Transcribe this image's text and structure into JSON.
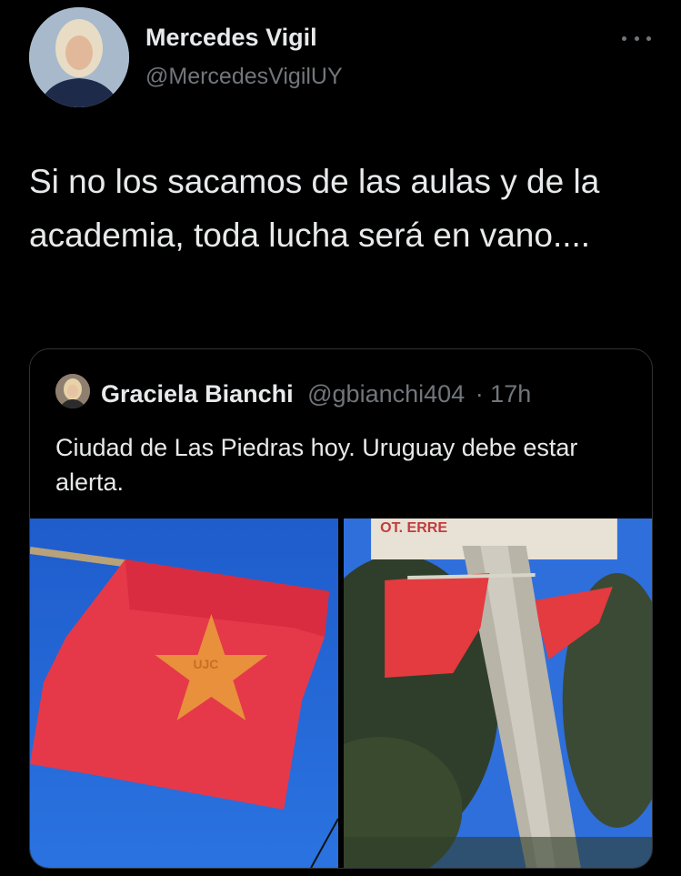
{
  "tweet": {
    "author": {
      "name": "Mercedes Vigil",
      "handle": "@MercedesVigilUY"
    },
    "more_icon": "more-icon",
    "text": "Si no los sacamos de las aulas y de la academia, toda lucha será en vano...."
  },
  "quoted_tweet": {
    "author": {
      "name": "Graciela Bianchi",
      "handle": "@gbianchi404",
      "time": "· 17h"
    },
    "text": "Ciudad de Las Piedras hoy. Uruguay debe estar alerta.",
    "media": [
      {
        "description_icon": "photo",
        "flag_text": "UJC"
      },
      {
        "description_icon": "photo",
        "sign_text": "OT. ERRE"
      }
    ]
  },
  "colors": {
    "background": "#000000",
    "text_primary": "#e7e9ea",
    "text_secondary": "#71767b",
    "border": "#2f3336",
    "flag_red": "#e5394a",
    "star_orange": "#e89a3a",
    "sky_blue": "#1f62d0"
  }
}
